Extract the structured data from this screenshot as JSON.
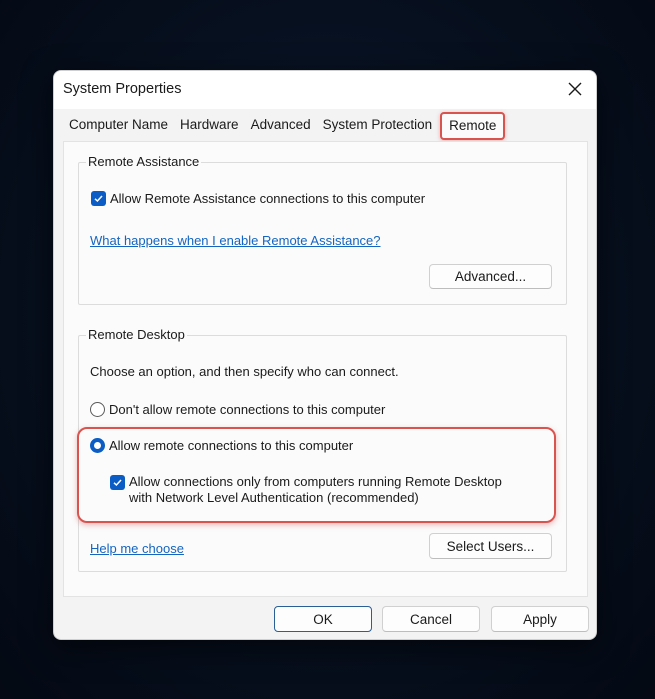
{
  "window": {
    "title": "System Properties",
    "close_icon": "close-icon"
  },
  "tabs": [
    {
      "label": "Computer Name",
      "active": false
    },
    {
      "label": "Hardware",
      "active": false
    },
    {
      "label": "Advanced",
      "active": false
    },
    {
      "label": "System Protection",
      "active": false
    },
    {
      "label": "Remote",
      "active": true
    }
  ],
  "remote_assistance": {
    "group_label": "Remote Assistance",
    "allow_checkbox": {
      "label": "Allow Remote Assistance connections to this computer",
      "checked": true
    },
    "help_link": "What happens when I enable Remote Assistance?",
    "advanced_button": "Advanced..."
  },
  "remote_desktop": {
    "group_label": "Remote Desktop",
    "instructions": "Choose an option, and then specify who can connect.",
    "options": [
      {
        "label": "Don't allow remote connections to this computer",
        "selected": false
      },
      {
        "label": "Allow remote connections to this computer",
        "selected": true
      }
    ],
    "nla_checkbox": {
      "line1": "Allow connections only from computers running Remote Desktop",
      "line2": "with Network Level Authentication (recommended)",
      "checked": true
    },
    "help_link": "Help me choose",
    "select_users_button": "Select Users..."
  },
  "footer": {
    "ok": "OK",
    "cancel": "Cancel",
    "apply": "Apply"
  },
  "colors": {
    "accent": "#0b5cc4",
    "highlight": "#d9534f",
    "link": "#1565c0"
  }
}
